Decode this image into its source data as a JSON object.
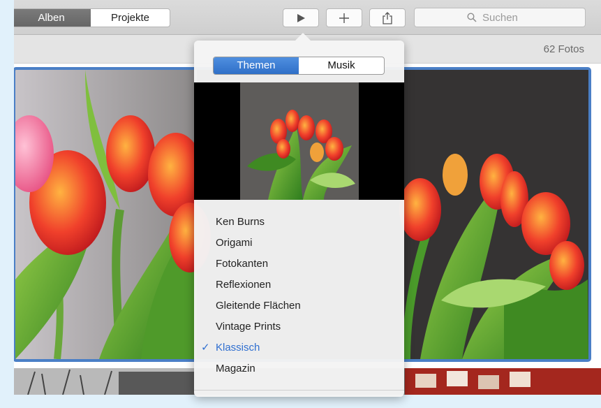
{
  "toolbar": {
    "nav": [
      {
        "label": "Alben",
        "active": true
      },
      {
        "label": "Projekte",
        "active": false
      }
    ],
    "play_icon": "play-icon",
    "add_icon": "plus-icon",
    "share_icon": "share-icon",
    "search": {
      "placeholder": "Suchen",
      "icon": "magnifier-icon"
    }
  },
  "album": {
    "photo_count": "62 Fotos"
  },
  "slideshow_popover": {
    "tabs": [
      {
        "label": "Themen",
        "active": true
      },
      {
        "label": "Musik",
        "active": false
      }
    ],
    "themes": [
      {
        "label": "Ken Burns",
        "selected": false
      },
      {
        "label": "Origami",
        "selected": false
      },
      {
        "label": "Fotokanten",
        "selected": false
      },
      {
        "label": "Reflexionen",
        "selected": false
      },
      {
        "label": "Gleitende Flächen",
        "selected": false
      },
      {
        "label": "Vintage Prints",
        "selected": false
      },
      {
        "label": "Klassisch",
        "selected": true
      },
      {
        "label": "Magazin",
        "selected": false
      }
    ],
    "check_icon": "checkmark-icon"
  },
  "colors": {
    "accent": "#2f6fd0",
    "selection_border": "#4a7fc6",
    "page_background": "#e1f1fb"
  }
}
